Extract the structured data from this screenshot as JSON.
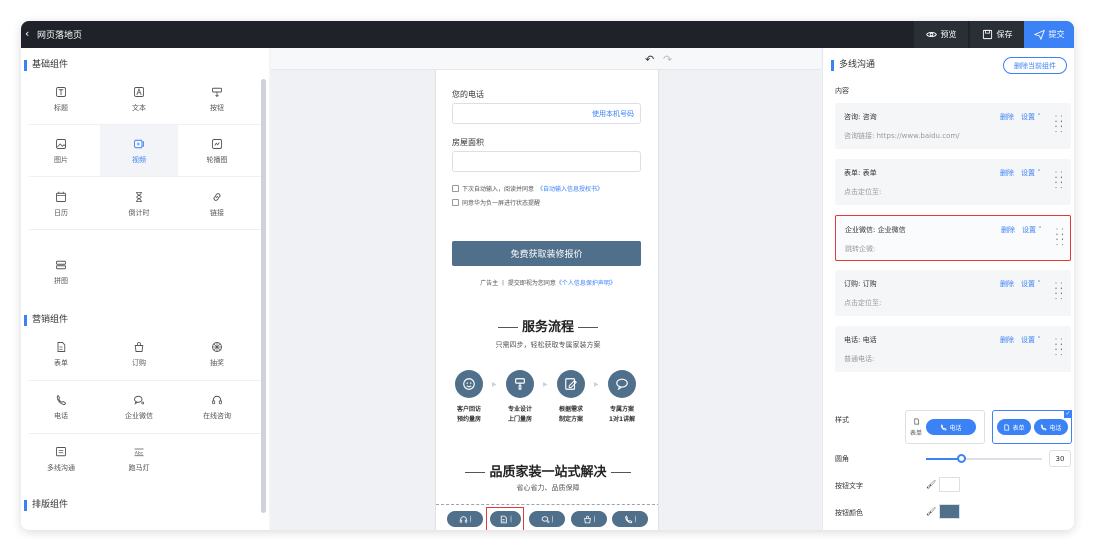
{
  "topbar": {
    "back_icon": "chevron-left-icon",
    "title": "网页落地页",
    "preview": "预览",
    "save": "保存",
    "submit": "提交"
  },
  "left": {
    "basic_title": "基础组件",
    "basic": [
      {
        "label": "标题",
        "icon": "title-icon"
      },
      {
        "label": "文本",
        "icon": "text-icon"
      },
      {
        "label": "按钮",
        "icon": "button-icon"
      },
      {
        "label": "图片",
        "icon": "image-icon"
      },
      {
        "label": "视频",
        "icon": "video-icon"
      },
      {
        "label": "轮播图",
        "icon": "carousel-icon"
      },
      {
        "label": "日历",
        "icon": "calendar-icon"
      },
      {
        "label": "倒计时",
        "icon": "hourglass-icon"
      },
      {
        "label": "链接",
        "icon": "link-icon"
      },
      {
        "label": "拼图",
        "icon": "puzzle-icon"
      }
    ],
    "marketing_title": "营销组件",
    "marketing": [
      {
        "label": "表单",
        "icon": "form-icon"
      },
      {
        "label": "订购",
        "icon": "bag-icon"
      },
      {
        "label": "抽奖",
        "icon": "lottery-icon"
      },
      {
        "label": "电话",
        "icon": "phone-icon"
      },
      {
        "label": "企业微信",
        "icon": "wecom-icon"
      },
      {
        "label": "在线咨询",
        "icon": "headset-icon"
      },
      {
        "label": "多线沟通",
        "icon": "multiline-icon"
      },
      {
        "label": "跑马灯",
        "icon": "marquee-icon"
      }
    ],
    "layout_title": "排版组件",
    "layout": [
      {
        "label": "",
        "icon": "column-icon"
      },
      {
        "label": "",
        "icon": "rect-icon"
      }
    ]
  },
  "center": {
    "phone_label": "您的电话",
    "phone_suffix": "使用本机号码",
    "area_label": "房屋面积",
    "check1_text": "下次自动输入，阅读并同意",
    "check1_link": "《自动输入信息授权书》",
    "check2_text": "同意华为负一屏进行状态提醒",
    "cta": "免费获取装修报价",
    "ad_text": "广告主 丨 提交即视为您同意",
    "ad_link": "《个人信息保护声明》",
    "section1_title": "服务流程",
    "section1_sub": "只需四步，轻松获取专属家装方案",
    "flow": [
      {
        "line1": "客户回访",
        "line2": "预约量房",
        "icon": "smile-icon"
      },
      {
        "line1": "专业设计",
        "line2": "上门量房",
        "icon": "brush-icon"
      },
      {
        "line1": "根据需求",
        "line2": "制定方案",
        "icon": "edit-icon"
      },
      {
        "line1": "专属方案",
        "line2": "1对1讲解",
        "icon": "chat-icon"
      }
    ],
    "section2_title": "品质家装一站式解决",
    "section2_sub": "省心省力、品质保障",
    "bottom_icons": [
      "headset-icon",
      "form-icon",
      "wecom-icon",
      "bag-icon",
      "phone-icon"
    ]
  },
  "right": {
    "title": "多线沟通",
    "delete_component": "删除当前组件",
    "content_label": "内容",
    "cards": [
      {
        "name": "咨询: 咨询",
        "sub": "咨询链接: https://www.baidu.com/",
        "selected": false
      },
      {
        "name": "表单: 表单",
        "sub": "点击定位至:",
        "selected": false
      },
      {
        "name": "企业微信: 企业微信",
        "sub": "跳转企微:",
        "selected": true
      },
      {
        "name": "订购: 订购",
        "sub": "点击定位至:",
        "selected": false
      },
      {
        "name": "电话: 电话",
        "sub": "普通电话:",
        "selected": false
      }
    ],
    "delete": "删除",
    "settings": "设置",
    "style_label": "样式",
    "style1_side": "表单",
    "style1_pill": "电话",
    "style2_pill1": "表单",
    "style2_pill2": "电话",
    "radius_label": "圆角",
    "radius_value": "30",
    "radius_fraction": 0.3,
    "btn_text_label": "按钮文字",
    "btn_color_label": "按钮颜色",
    "btn_text_color": "#ffffff",
    "btn_color": "#4f6f8a"
  }
}
